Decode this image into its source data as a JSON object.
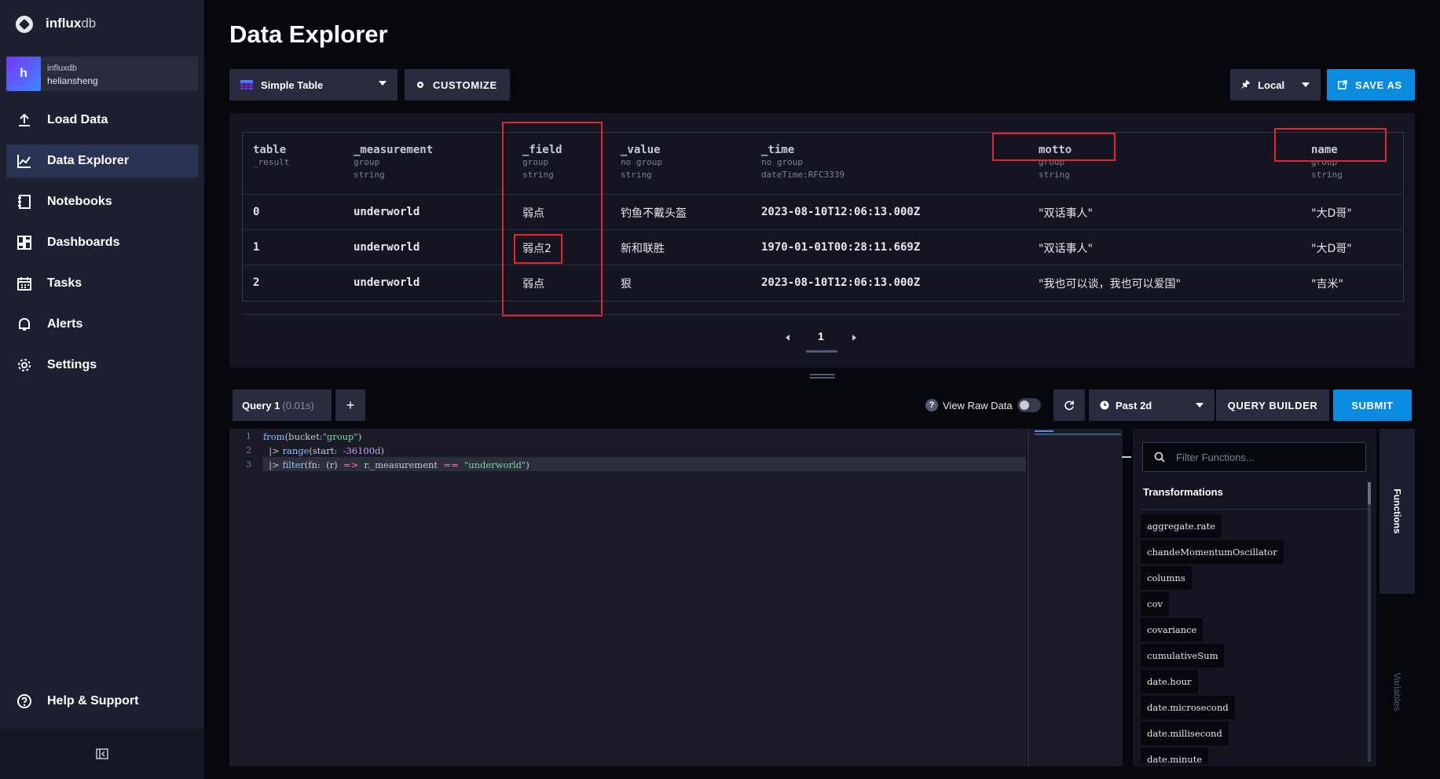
{
  "brand": {
    "name_bold": "influx",
    "name_light": "db"
  },
  "org": {
    "avatar_letter": "h",
    "name": "influxdb",
    "user": "heliansheng"
  },
  "nav": {
    "items": [
      {
        "label": "Load Data",
        "icon": "upload-icon"
      },
      {
        "label": "Data Explorer",
        "icon": "graph-icon",
        "active": true
      },
      {
        "label": "Notebooks",
        "icon": "notebook-icon"
      },
      {
        "label": "Dashboards",
        "icon": "dashboard-icon"
      },
      {
        "label": "Tasks",
        "icon": "calendar-icon"
      },
      {
        "label": "Alerts",
        "icon": "bell-icon"
      },
      {
        "label": "Settings",
        "icon": "gear-icon"
      }
    ],
    "help_label": "Help & Support"
  },
  "page": {
    "title": "Data Explorer"
  },
  "toolbar": {
    "viz_type": "Simple Table",
    "customize_label": "CUSTOMIZE",
    "local_label": "Local",
    "save_as_label": "SAVE AS"
  },
  "table": {
    "columns": [
      {
        "name": "table",
        "sub1": "_result",
        "sub2": ""
      },
      {
        "name": "_measurement",
        "sub1": "group",
        "sub2": "string"
      },
      {
        "name": "_field",
        "sub1": "group",
        "sub2": "string"
      },
      {
        "name": "_value",
        "sub1": "no group",
        "sub2": "string"
      },
      {
        "name": "_time",
        "sub1": "no group",
        "sub2": "dateTime:RFC3339"
      },
      {
        "name": "motto",
        "sub1": "group",
        "sub2": "string"
      },
      {
        "name": "name",
        "sub1": "group",
        "sub2": "string"
      }
    ],
    "rows": [
      [
        "0",
        "underworld",
        "弱点",
        "钓鱼不戴头盔",
        "2023-08-10T12:06:13.000Z",
        "\"双话事人\"",
        "\"大D哥\""
      ],
      [
        "1",
        "underworld",
        "弱点2",
        "新和联胜",
        "1970-01-01T00:28:11.669Z",
        "\"双话事人\"",
        "\"大D哥\""
      ],
      [
        "2",
        "underworld",
        "弱点",
        "狠",
        "2023-08-10T12:06:13.000Z",
        "\"我也可以谈，我也可以爱国\"",
        "\"吉米\""
      ]
    ],
    "current_page": "1"
  },
  "query": {
    "tab_label": "Query 1",
    "tab_time": "(0.01s)",
    "add_label": "+",
    "raw_data_label": "View Raw Data",
    "raw_data_enabled": false,
    "time_range": "Past 2d",
    "query_builder_label": "QUERY BUILDER",
    "submit_label": "SUBMIT",
    "editor_lines": [
      {
        "num": "1",
        "parts": [
          [
            "kw",
            "from"
          ],
          [
            "plain",
            "(bucket:"
          ],
          [
            "str",
            "\"group\""
          ],
          [
            "plain",
            ")"
          ]
        ]
      },
      {
        "num": "2",
        "parts": [
          [
            "plain",
            "  |> "
          ],
          [
            "kw",
            "range"
          ],
          [
            "plain",
            "(start:  "
          ],
          [
            "num",
            "-36100d"
          ],
          [
            "plain",
            ")"
          ]
        ]
      },
      {
        "num": "3",
        "parts": [
          [
            "plain",
            "  |> "
          ],
          [
            "kw",
            "filter"
          ],
          [
            "plain",
            "(fn:  (r)  "
          ],
          [
            "op",
            "=>"
          ],
          [
            "plain",
            "  r._measurement  "
          ],
          [
            "op",
            "=="
          ],
          [
            "plain",
            "  "
          ],
          [
            "str",
            "\"underworld\""
          ],
          [
            "plain",
            ")"
          ]
        ]
      }
    ]
  },
  "functions": {
    "search_placeholder": "Filter Functions...",
    "heading": "Transformations",
    "items": [
      "aggregate.rate",
      "chandeMomentumOscillator",
      "columns",
      "cov",
      "covariance",
      "cumulativeSum",
      "date.hour",
      "date.microsecond",
      "date.millisecond",
      "date.minute"
    ],
    "tabs": [
      "Functions",
      "Variables"
    ]
  },
  "colors": {
    "accent": "#0a8be0",
    "highlight_box": "#e2262b",
    "sidebar": "#1d2030"
  }
}
